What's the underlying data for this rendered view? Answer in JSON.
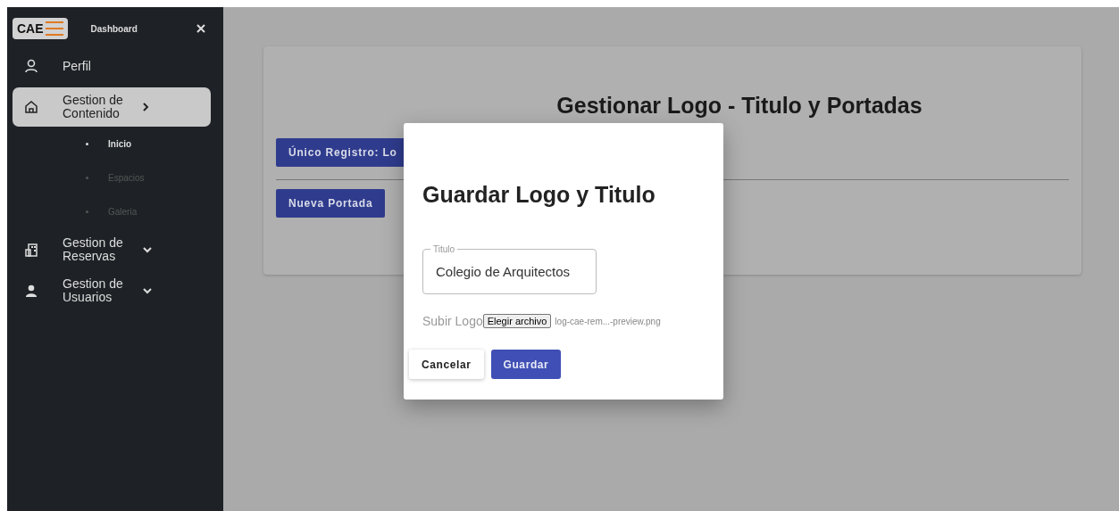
{
  "sidebar": {
    "logo": "CAE",
    "title": "Dashboard",
    "items": [
      {
        "label": "Perfil",
        "selected": false,
        "kind": "link"
      },
      {
        "label": "Gestion de Contenido",
        "selected": true,
        "kind": "group",
        "children": [
          {
            "label": "Inicio",
            "selected": true
          },
          {
            "label": "Espacios",
            "selected": false
          },
          {
            "label": "Galeria",
            "selected": false
          }
        ]
      },
      {
        "label": "Gestion de Reservas",
        "selected": false,
        "kind": "group"
      },
      {
        "label": "Gestion de Usuarios",
        "selected": false,
        "kind": "group"
      }
    ]
  },
  "page": {
    "title": "Gestionar Logo - Titulo y Portadas",
    "record_button": "Único Registro: Lo",
    "new_cover_button": "Nueva Portada"
  },
  "dialog": {
    "title": "Guardar Logo y Titulo",
    "field": {
      "label": "Titulo",
      "value": "Colegio de Arquitectos"
    },
    "upload": {
      "label": "Subir Logo",
      "button": "Elegir archivo",
      "file": "log-cae-rem...-preview.png"
    },
    "buttons": [
      {
        "label": "Cancelar",
        "kind": "secondary"
      },
      {
        "label": "Guardar",
        "kind": "primary"
      }
    ]
  }
}
